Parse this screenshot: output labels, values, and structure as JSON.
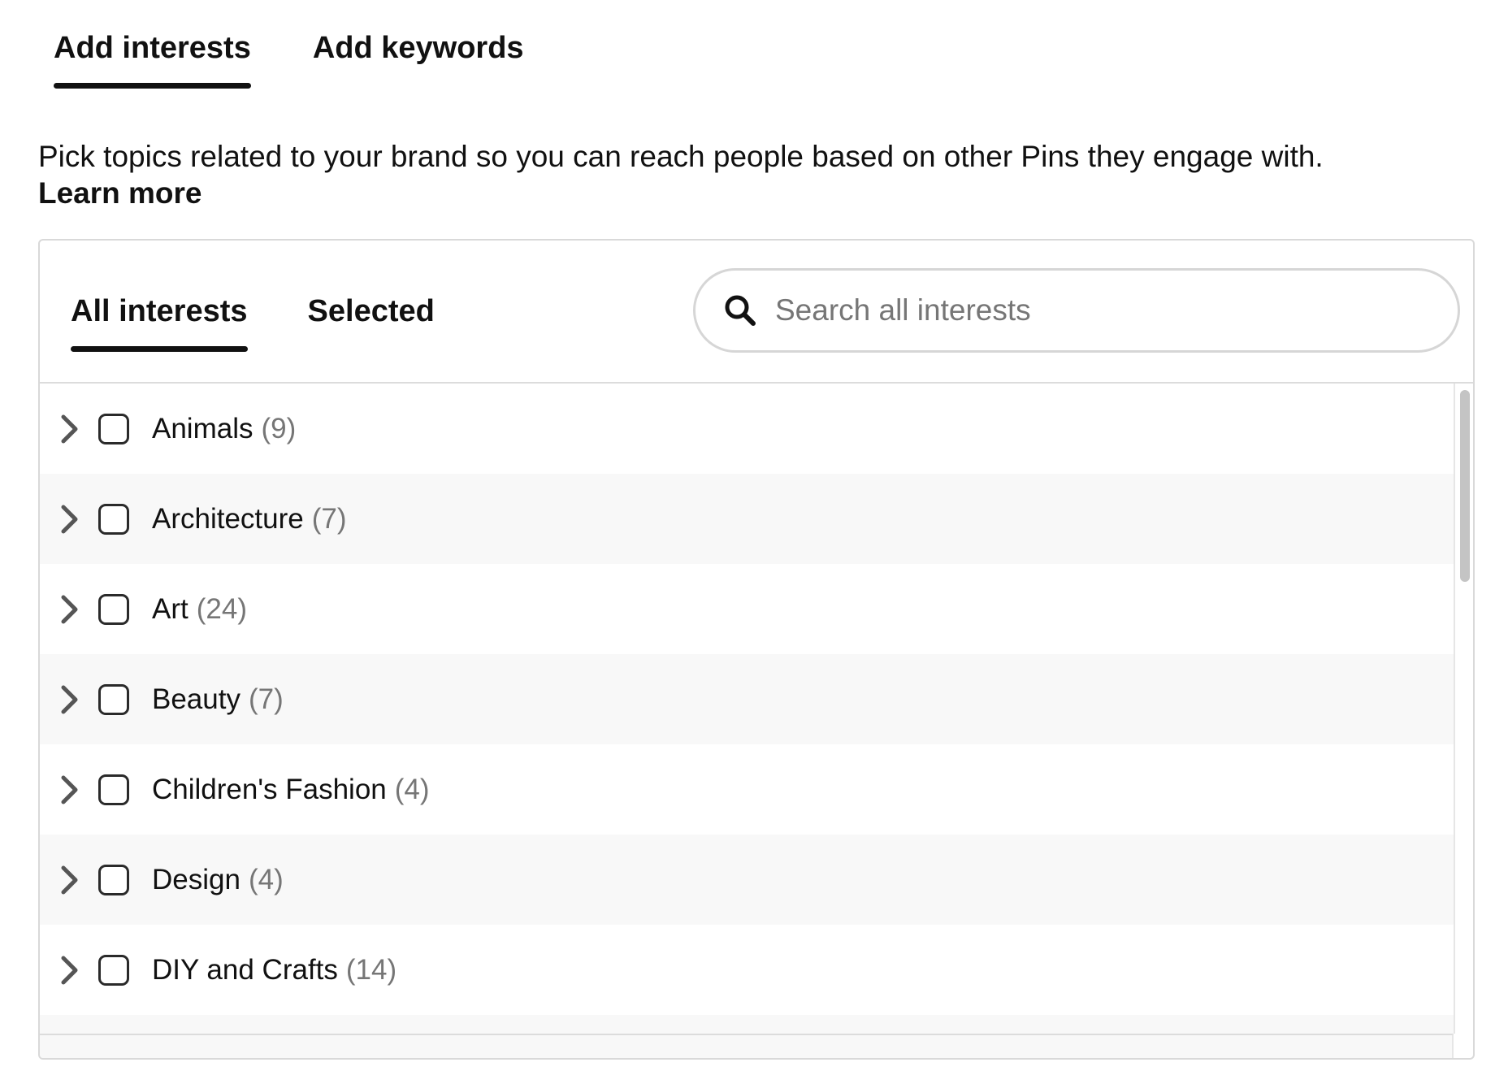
{
  "top_tabs": [
    {
      "label": "Add interests",
      "active": true
    },
    {
      "label": "Add keywords",
      "active": false
    }
  ],
  "description": {
    "text": "Pick topics related to your brand so you can reach people based on other Pins they engage with.",
    "link": "Learn more"
  },
  "panel": {
    "tabs": [
      {
        "label": "All interests",
        "active": true
      },
      {
        "label": "Selected",
        "active": false
      }
    ],
    "search": {
      "placeholder": "Search all interests",
      "value": "",
      "icon": "search-icon"
    },
    "items": [
      {
        "label": "Animals",
        "count": "(9)"
      },
      {
        "label": "Architecture",
        "count": "(7)"
      },
      {
        "label": "Art",
        "count": "(24)"
      },
      {
        "label": "Beauty",
        "count": "(7)"
      },
      {
        "label": "Children's Fashion",
        "count": "(4)"
      },
      {
        "label": "Design",
        "count": "(4)"
      },
      {
        "label": "DIY and Crafts",
        "count": "(14)"
      }
    ]
  },
  "colors": {
    "text": "#111111",
    "muted": "#767676",
    "row_alt_bg": "#f8f8f8",
    "border": "#d9d9d9"
  }
}
